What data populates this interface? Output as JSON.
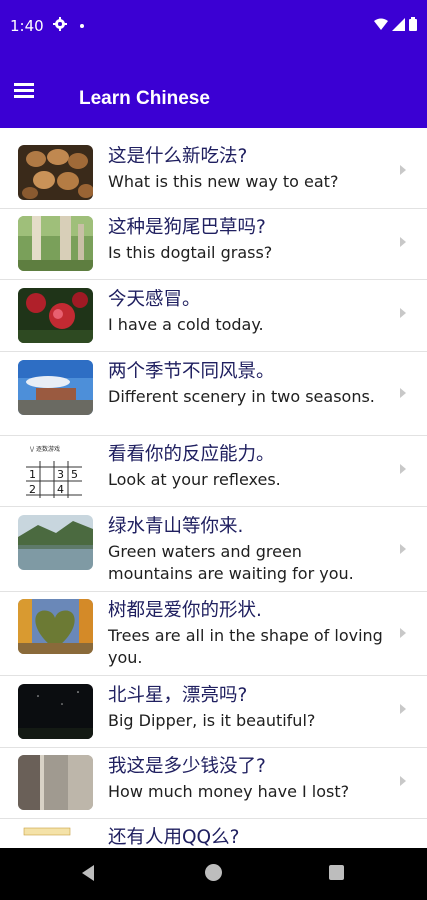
{
  "status_bar": {
    "time": "1:40",
    "icons": [
      "gear-icon",
      "dot-icon",
      "wifi-icon",
      "signal-icon",
      "battery-icon"
    ]
  },
  "app_bar": {
    "title": "Learn Chinese",
    "menu_icon": "hamburger-menu-icon",
    "color": "#3b00d3"
  },
  "lessons": [
    {
      "zh": "这是什么新吃法?",
      "en": "What is this new way to eat?",
      "thumb": "eggs-photo"
    },
    {
      "zh": "这种是狗尾巴草吗?",
      "en": "Is this dogtail grass?",
      "thumb": "grass-photo"
    },
    {
      "zh": "今天感冒。",
      "en": "I have a cold today.",
      "thumb": "red-flowers-photo"
    },
    {
      "zh": "两个季节不同风景。",
      "en": "Different scenery in two seasons.",
      "thumb": "building-sky-photo"
    },
    {
      "zh": "看看你的反应能力。",
      "en": "Look at your reflexes.",
      "thumb": "number-grid-photo",
      "grid_caption": "\\/ 逐数游戏",
      "grid_numbers": [
        "1",
        "3",
        "5",
        "2",
        "4"
      ]
    },
    {
      "zh": "绿水青山等你来.",
      "en": "Green waters and green mountains are waiting for you.",
      "thumb": "lake-photo"
    },
    {
      "zh": "树都是爱你的形状.",
      "en": "Trees are all in the shape of loving you.",
      "thumb": "heart-trees-photo"
    },
    {
      "zh": "北斗星，漂亮吗?",
      "en": "Big Dipper, is it beautiful?",
      "thumb": "night-sky-photo"
    },
    {
      "zh": "我这是多少钱没了?",
      "en": "How much money have I lost?",
      "thumb": "blurry-phone-photo"
    },
    {
      "zh": "还有人用QQ么?",
      "en": "",
      "thumb": "qq-photo"
    }
  ],
  "nav_bar": {
    "back": "back-icon",
    "home": "home-icon",
    "recents": "recents-icon"
  }
}
